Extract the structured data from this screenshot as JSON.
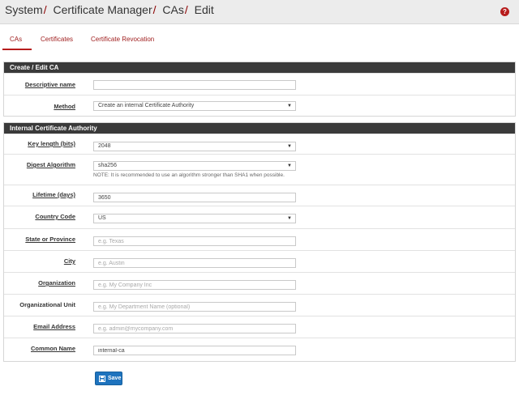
{
  "breadcrumb": {
    "items": [
      "System",
      "Certificate Manager",
      "CAs",
      "Edit"
    ],
    "separator": "/"
  },
  "help_icon_glyph": "?",
  "tabs": [
    {
      "label": "CAs",
      "active": true
    },
    {
      "label": "Certificates",
      "active": false
    },
    {
      "label": "Certificate Revocation",
      "active": false
    }
  ],
  "create_panel": {
    "title": "Create / Edit CA",
    "descriptive_name": {
      "label": "Descriptive name",
      "value": ""
    },
    "method": {
      "label": "Method",
      "value": "Create an internal Certificate Authority"
    }
  },
  "internal_panel": {
    "title": "Internal Certificate Authority",
    "key_length": {
      "label": "Key length (bits)",
      "value": "2048"
    },
    "digest_algorithm": {
      "label": "Digest Algorithm",
      "value": "sha256",
      "note": "NOTE: It is recommended to use an algorithm stronger than SHA1 when possible."
    },
    "lifetime": {
      "label": "Lifetime (days)",
      "value": "3650"
    },
    "country_code": {
      "label": "Country Code",
      "value": "US"
    },
    "state": {
      "label": "State or Province",
      "value": "",
      "placeholder": "e.g. Texas"
    },
    "city": {
      "label": "City",
      "value": "",
      "placeholder": "e.g. Austin"
    },
    "organization": {
      "label": "Organization",
      "value": "",
      "placeholder": "e.g. My Company Inc"
    },
    "org_unit": {
      "label": "Organizational Unit",
      "value": "",
      "placeholder": "e.g. My Department Name (optional)"
    },
    "email": {
      "label": "Email Address",
      "value": "",
      "placeholder": "e.g. admin@mycompany.com"
    },
    "common_name": {
      "label": "Common Name",
      "value": "internal-ca"
    }
  },
  "save_button": {
    "label": "Save",
    "icon": "save-icon"
  },
  "colors": {
    "accent_red": "#b71c1c",
    "panel_header": "#3a3a3a",
    "primary_button": "#1e73be"
  }
}
